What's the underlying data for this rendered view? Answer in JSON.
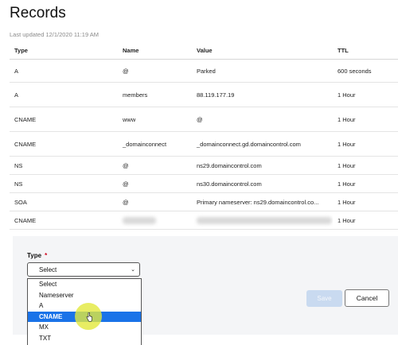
{
  "page": {
    "title": "Records",
    "last_updated": "Last updated 12/1/2020 11:19 AM"
  },
  "table": {
    "headers": [
      "Type",
      "Name",
      "Value",
      "TTL"
    ],
    "rows": [
      {
        "type": "A",
        "name": "@",
        "value": "Parked",
        "ttl": "600 seconds"
      },
      {
        "type": "A",
        "name": "members",
        "value": "88.119.177.19",
        "ttl": "1 Hour"
      },
      {
        "type": "CNAME",
        "name": "www",
        "value": "@",
        "ttl": "1 Hour"
      },
      {
        "type": "CNAME",
        "name": "_domainconnect",
        "value": "_domainconnect.gd.domaincontrol.com",
        "ttl": "1 Hour"
      },
      {
        "type": "NS",
        "name": "@",
        "value": "ns29.domaincontrol.com",
        "ttl": "1 Hour"
      },
      {
        "type": "NS",
        "name": "@",
        "value": "ns30.domaincontrol.com",
        "ttl": "1 Hour"
      },
      {
        "type": "SOA",
        "name": "@",
        "value": "Primary nameserver: ns29.domaincontrol.co...",
        "ttl": "1 Hour"
      },
      {
        "type": "CNAME",
        "name": "",
        "value": "",
        "ttl": "1 Hour"
      }
    ]
  },
  "form": {
    "type_label": "Type",
    "required_mark": "*",
    "select_value": "Select",
    "options": [
      "Select",
      "Nameserver",
      "A",
      "CNAME",
      "MX",
      "TXT"
    ],
    "highlighted_option": "CNAME",
    "save_label": "Save",
    "cancel_label": "Cancel"
  },
  "colors": {
    "accent": "#1a73e8",
    "required": "#d0021b",
    "save_disabled": "#c9daf0"
  }
}
